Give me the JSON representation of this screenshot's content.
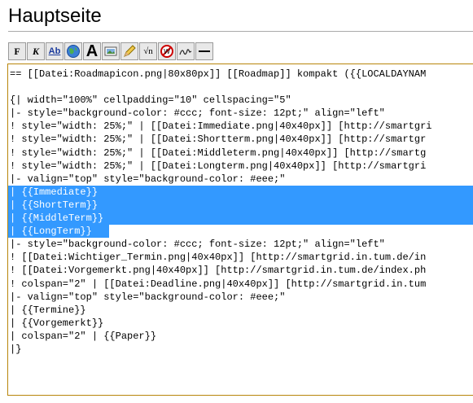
{
  "page": {
    "title": "Hauptseite"
  },
  "toolbar": {
    "buttons": [
      {
        "name": "bold-button",
        "icon": "bold-icon",
        "label": "F"
      },
      {
        "name": "italic-button",
        "icon": "italic-icon",
        "label": "K"
      },
      {
        "name": "internal-link-button",
        "icon": "link-icon",
        "label": "Ab"
      },
      {
        "name": "external-link-button",
        "icon": "globe-icon",
        "label": ""
      },
      {
        "name": "headline-button",
        "icon": "headline-icon",
        "label": "A"
      },
      {
        "name": "image-button",
        "icon": "image-icon",
        "label": ""
      },
      {
        "name": "media-button",
        "icon": "pencil-icon",
        "label": ""
      },
      {
        "name": "math-button",
        "icon": "math-icon",
        "label": "√n"
      },
      {
        "name": "nowiki-button",
        "icon": "nowiki-icon",
        "label": ""
      },
      {
        "name": "signature-button",
        "icon": "signature-icon",
        "label": ""
      },
      {
        "name": "hr-button",
        "icon": "hr-icon",
        "label": ""
      }
    ]
  },
  "editor": {
    "lines": [
      "== [[Datei:Roadmapicon.png|80x80px]] [[Roadmap]] kompakt ({{LOCALDAYNAM",
      "",
      "{| width=\"100%\" cellpadding=\"10\" cellspacing=\"5\"",
      "|- style=\"background-color: #ccc; font-size: 12pt;\" align=\"left\"",
      "! style=\"width: 25%;\" | [[Datei:Immediate.png|40x40px]] [http://smartgri",
      "! style=\"width: 25%;\" | [[Datei:Shortterm.png|40x40px]] [http://smartgr",
      "! style=\"width: 25%;\" | [[Datei:Middleterm.png|40x40px]] [http://smartg",
      "! style=\"width: 25%;\" | [[Datei:Longterm.png|40x40px]] [http://smartgri",
      "|- valign=\"top\" style=\"background-color: #eee;\"",
      "| {{Immediate}}",
      "| {{ShortTerm}}",
      "| {{MiddleTerm}}",
      "| {{LongTerm}}",
      "|- style=\"background-color: #ccc; font-size: 12pt;\" align=\"left\"",
      "! [[Datei:Wichtiger_Termin.png|40x40px]] [http://smartgrid.in.tum.de/in",
      "! [[Datei:Vorgemerkt.png|40x40px]] [http://smartgrid.in.tum.de/index.ph",
      "! colspan=\"2\" | [[Datei:Deadline.png|40x40px]] [http://smartgrid.in.tum",
      "|- valign=\"top\" style=\"background-color: #eee;\"",
      "| {{Termine}}",
      "| {{Vorgemerkt}}",
      "| colspan=\"2\" | {{Paper}}",
      "|}"
    ],
    "selected_lines": [
      9,
      10,
      11,
      12
    ],
    "selection_color": "#3399ff",
    "border_color": "#b8860b"
  }
}
